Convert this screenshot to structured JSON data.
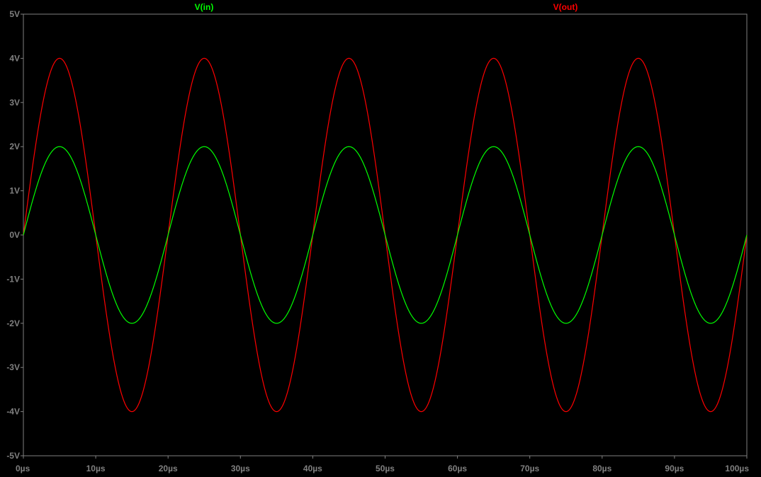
{
  "colors": {
    "background": "#000000",
    "axis": "#808080",
    "vin": "#00ff00",
    "vout": "#ff0000"
  },
  "chart_data": {
    "type": "line",
    "xlabel": "",
    "ylabel": "",
    "xlim": [
      0,
      100
    ],
    "ylim": [
      -5,
      5
    ],
    "x_unit": "µs",
    "grid": false,
    "x_ticks": [
      "0µs",
      "10µs",
      "20µs",
      "30µs",
      "40µs",
      "50µs",
      "60µs",
      "70µs",
      "80µs",
      "90µs",
      "100µs"
    ],
    "y_ticks": [
      "5V",
      "4V",
      "3V",
      "2V",
      "1V",
      "0V",
      "-1V",
      "-2V",
      "-3V",
      "-4V",
      "-5V"
    ],
    "x_tick_values": [
      0,
      10,
      20,
      30,
      40,
      50,
      60,
      70,
      80,
      90,
      100
    ],
    "y_tick_values": [
      5,
      4,
      3,
      2,
      1,
      0,
      -1,
      -2,
      -3,
      -4,
      -5
    ],
    "legend_position": "top",
    "series": [
      {
        "name": "V(in)",
        "color": "#00ff00",
        "waveform": "sine",
        "amplitude": 2,
        "frequency_per_us": 0.05,
        "x": [
          0,
          5,
          10,
          15,
          20,
          25,
          30,
          35,
          40,
          45,
          50,
          55,
          60,
          65,
          70,
          75,
          80,
          85,
          90,
          95,
          100
        ],
        "y": [
          0,
          2,
          0,
          -2,
          0,
          2,
          0,
          -2,
          0,
          2,
          0,
          -2,
          0,
          2,
          0,
          -2,
          0,
          2,
          0,
          -2,
          0
        ]
      },
      {
        "name": "V(out)",
        "color": "#ff0000",
        "waveform": "sine",
        "amplitude": 4,
        "frequency_per_us": 0.05,
        "x": [
          0,
          5,
          10,
          15,
          20,
          25,
          30,
          35,
          40,
          45,
          50,
          55,
          60,
          65,
          70,
          75,
          80,
          85,
          90,
          95,
          100
        ],
        "y": [
          0,
          4,
          0,
          -4,
          0,
          4,
          0,
          -4,
          0,
          4,
          0,
          -4,
          0,
          4,
          0,
          -4,
          0,
          4,
          0,
          -4,
          0
        ]
      }
    ]
  }
}
